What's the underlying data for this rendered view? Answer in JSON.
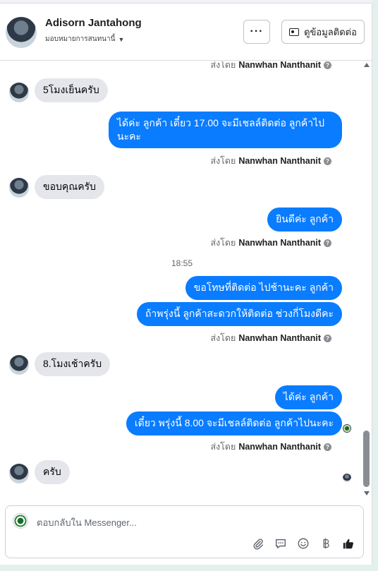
{
  "header": {
    "name": "Adisorn Jantahong",
    "assigned_label": "มอบหมายการสนทนานี้",
    "more_label": "···",
    "contact_button_label": "ดูข้อมูลติดต่อ"
  },
  "messages": {
    "top_sent_by": {
      "prefix": "ส่งโดย",
      "name": "Nanwhan Nanthanit"
    },
    "m1": {
      "text": "5โมงเย็นครับ"
    },
    "m2": {
      "text": "ได้ค่ะ ลูกค้า เดี๋ยว 17.00 จะมีเชลล์ติดต่อ ลูกค้าไปนะคะ"
    },
    "m2_sent_by": {
      "prefix": "ส่งโดย",
      "name": "Nanwhan Nanthanit"
    },
    "m3": {
      "text": "ขอบคุณครับ"
    },
    "m4": {
      "text": "ยินดีค่ะ ลูกค้า"
    },
    "m4_sent_by": {
      "prefix": "ส่งโดย",
      "name": "Nanwhan Nanthanit"
    },
    "timestamp": "18:55",
    "m5": {
      "text": "ขอโทษที่ติดต่อ ไปช้านะคะ ลูกค้า"
    },
    "m6": {
      "text": "ถ้าพรุ่งนี้ ลูกค้าสะดวกให้ติดต่อ ช่วงกี่โมงดีคะ"
    },
    "m6_sent_by": {
      "prefix": "ส่งโดย",
      "name": "Nanwhan Nanthanit"
    },
    "m7": {
      "text": "8.โมงเช้าครับ"
    },
    "m8": {
      "text": "ได้ค่ะ ลูกค้า"
    },
    "m9": {
      "text": "เดี๋ยว พรุ่งนี้ 8.00 จะมีเชลล์ติดต่อ ลูกค้าไปนะคะ"
    },
    "m9_sent_by": {
      "prefix": "ส่งโดย",
      "name": "Nanwhan Nanthanit"
    },
    "m10": {
      "text": "ครับ"
    }
  },
  "composer": {
    "placeholder": "ตอบกลับใน Messenger...",
    "tools": [
      "attach-icon",
      "saved-reply-icon",
      "emoji-icon",
      "currency-icon",
      "like-icon"
    ]
  },
  "colors": {
    "outgoing_bubble": "#0a7cff",
    "incoming_bubble": "#e4e6eb",
    "background": "#e4f0ed"
  }
}
